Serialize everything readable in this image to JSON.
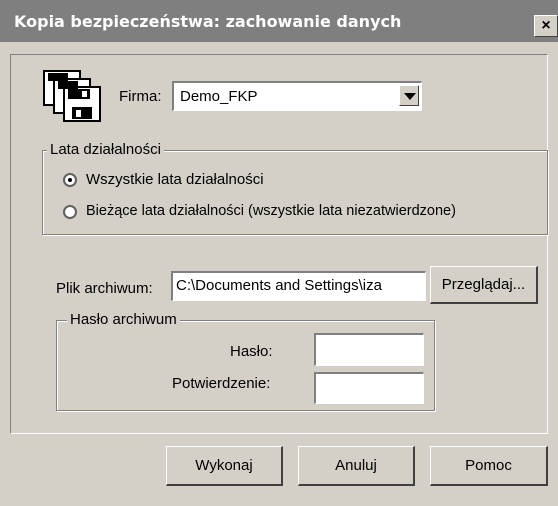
{
  "window": {
    "title": "Kopia bezpieczeństwa: zachowanie danych",
    "close_label": "×"
  },
  "firm": {
    "icon": "floppy-disks-icon",
    "label": "Firma:",
    "selected": "Demo_FKP"
  },
  "years_group": {
    "legend": "Lata działalności",
    "options": [
      {
        "label": "Wszystkie lata działalności",
        "selected": true
      },
      {
        "label": "Bieżące lata działalności (wszystkie lata niezatwierdzone)",
        "selected": false
      }
    ]
  },
  "archive": {
    "file_label": "Plik archiwum:",
    "file_value": "C:\\Documents and Settings\\iza",
    "browse_label": "Przeglądaj..."
  },
  "password_group": {
    "legend": "Hasło archiwum",
    "password_label": "Hasło:",
    "password_value": "",
    "confirm_label": "Potwierdzenie:",
    "confirm_value": ""
  },
  "buttons": {
    "execute": "Wykonaj",
    "cancel": "Anuluj",
    "help": "Pomoc"
  }
}
